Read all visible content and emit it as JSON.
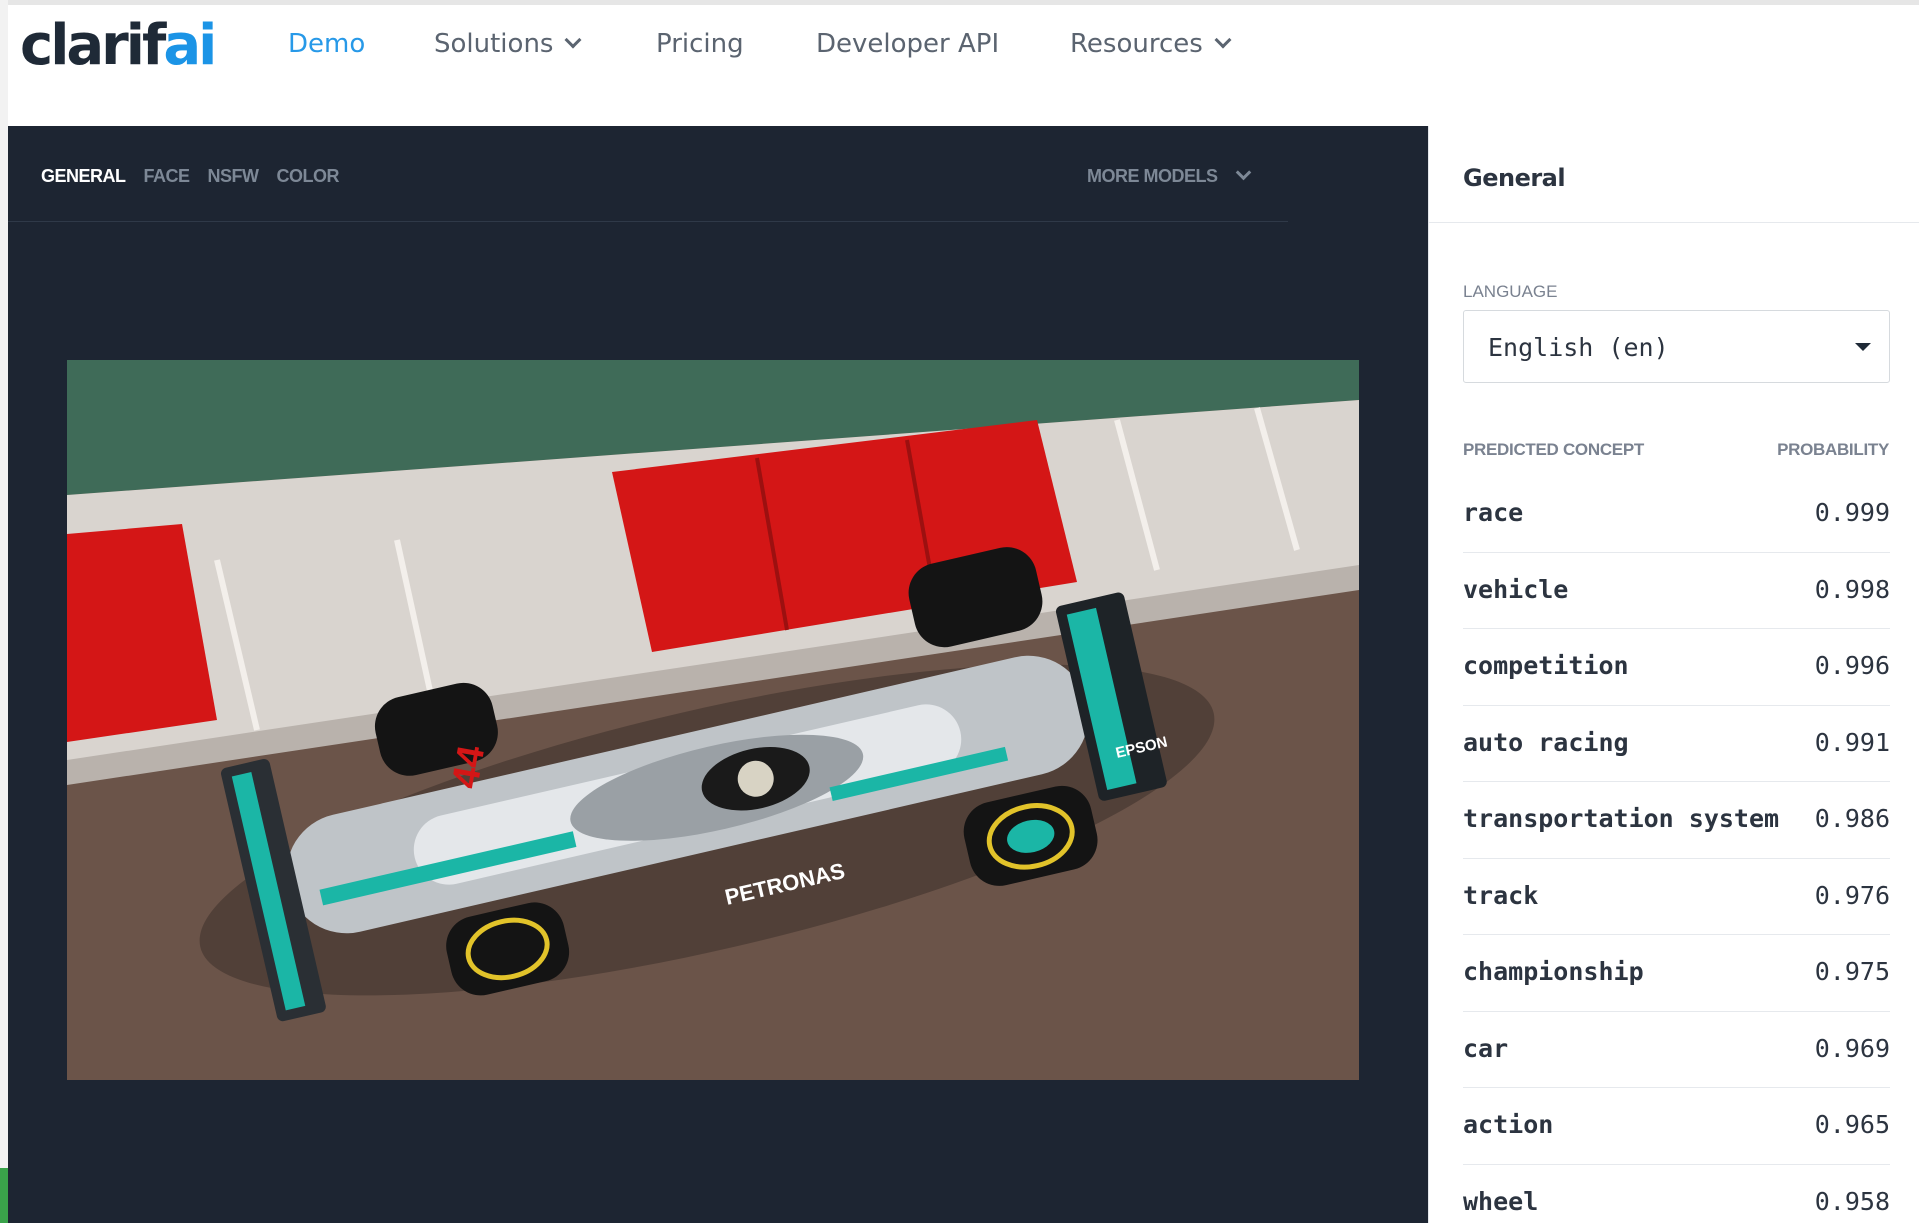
{
  "brand": {
    "logo_main": "clarif",
    "logo_accent": "ai",
    "accent_color": "#1b94e6"
  },
  "nav": {
    "items": [
      {
        "label": "Demo",
        "active": true
      },
      {
        "label": "Solutions",
        "has_dropdown": true
      },
      {
        "label": "Pricing"
      },
      {
        "label": "Developer API"
      },
      {
        "label": "Resources",
        "has_dropdown": true
      }
    ]
  },
  "models": {
    "tabs": [
      {
        "label": "GENERAL",
        "active": true
      },
      {
        "label": "FACE"
      },
      {
        "label": "NSFW"
      },
      {
        "label": "COLOR"
      }
    ],
    "more_label": "MORE MODELS"
  },
  "results": {
    "title": "General",
    "language_label": "LANGUAGE",
    "language_value": "English (en)",
    "concept_header": "PREDICTED CONCEPT",
    "probability_header": "PROBABILITY",
    "rows": [
      {
        "concept": "race",
        "probability": "0.999"
      },
      {
        "concept": "vehicle",
        "probability": "0.998"
      },
      {
        "concept": "competition",
        "probability": "0.996"
      },
      {
        "concept": "auto racing",
        "probability": "0.991"
      },
      {
        "concept": "transportation system",
        "probability": "0.986"
      },
      {
        "concept": "track",
        "probability": "0.976"
      },
      {
        "concept": "championship",
        "probability": "0.975"
      },
      {
        "concept": "car",
        "probability": "0.969"
      },
      {
        "concept": "action",
        "probability": "0.965"
      },
      {
        "concept": "wheel",
        "probability": "0.958"
      }
    ]
  },
  "photo": {
    "subject": "race-car-photo",
    "car_number": "44",
    "sponsor_text": "PETRONAS",
    "wing_text": "EPSON"
  }
}
